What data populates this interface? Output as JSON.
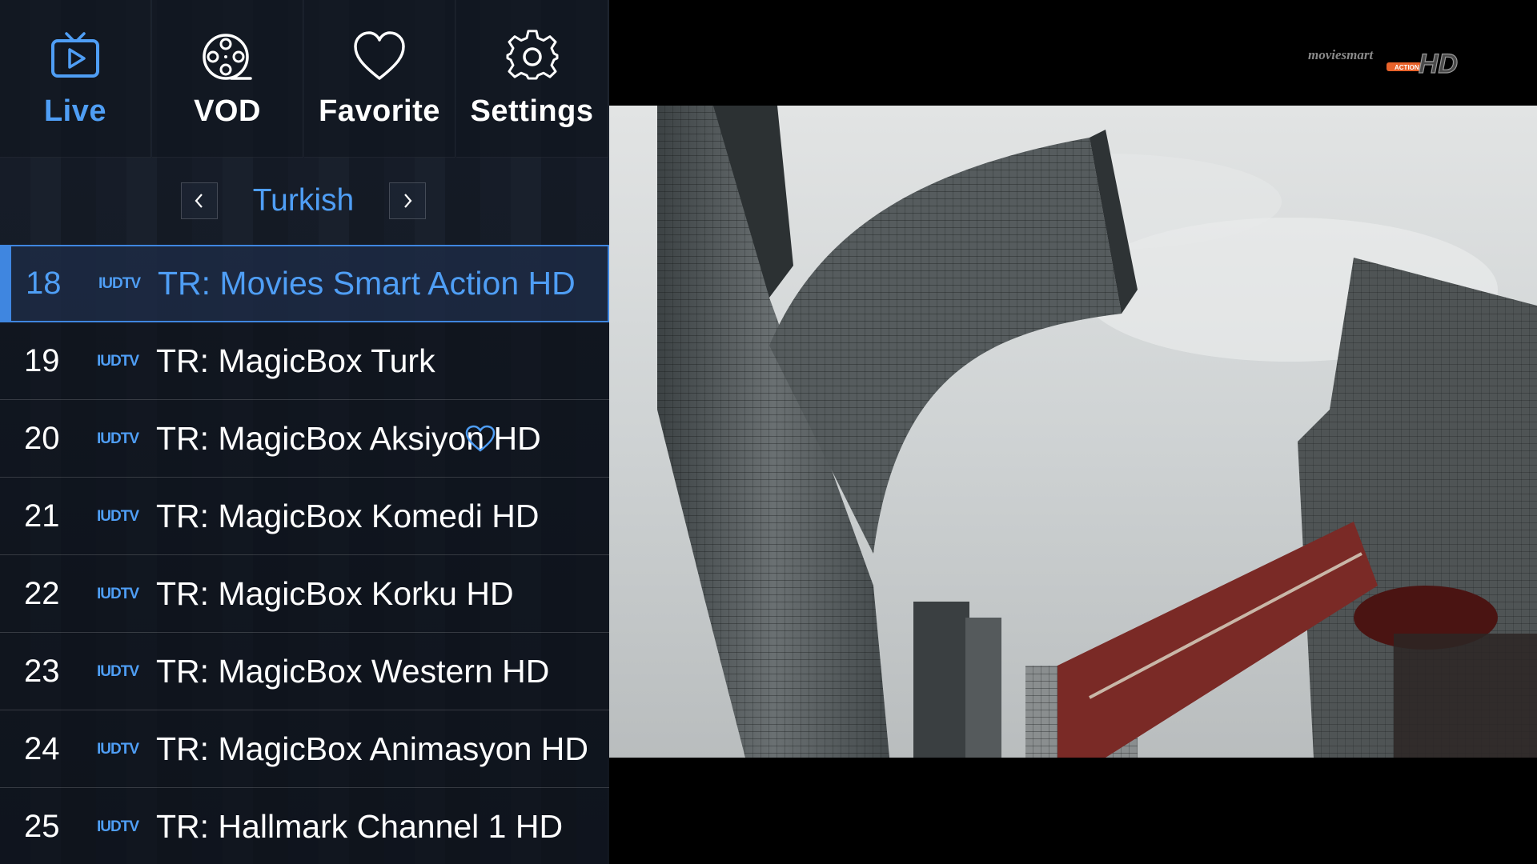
{
  "nav": {
    "items": [
      {
        "label": "Live",
        "icon": "tv-play-icon",
        "active": true
      },
      {
        "label": "VOD",
        "icon": "film-reel-icon",
        "active": false
      },
      {
        "label": "Favorite",
        "icon": "heart-icon",
        "active": false
      },
      {
        "label": "Settings",
        "icon": "gear-icon",
        "active": false
      }
    ]
  },
  "category": {
    "title": "Turkish",
    "prev_icon": "chevron-left-icon",
    "next_icon": "chevron-right-icon"
  },
  "channels": [
    {
      "number": "18",
      "logo": "IUDTV",
      "name": "TR: Movies Smart Action HD",
      "selected": true
    },
    {
      "number": "19",
      "logo": "IUDTV",
      "name": "TR: MagicBox Turk"
    },
    {
      "number": "20",
      "logo": "IUDTV",
      "name": "TR: MagicBox Aksiyon HD",
      "favorite": true
    },
    {
      "number": "21",
      "logo": "IUDTV",
      "name": "TR: MagicBox Komedi HD"
    },
    {
      "number": "22",
      "logo": "IUDTV",
      "name": "TR: MagicBox Korku HD"
    },
    {
      "number": "23",
      "logo": "IUDTV",
      "name": "TR: MagicBox Western HD"
    },
    {
      "number": "24",
      "logo": "IUDTV",
      "name": "TR: MagicBox Animasyon HD"
    },
    {
      "number": "25",
      "logo": "IUDTV",
      "name": "TR: Hallmark Channel 1 HD"
    }
  ],
  "player": {
    "channel_logo": {
      "brand": "moviesmart",
      "tag": "ACTION",
      "hd": "HD"
    }
  },
  "colors": {
    "accent": "#4f9ef5",
    "selected_border": "#3f86e0",
    "logo_orange": "#e8622a"
  }
}
